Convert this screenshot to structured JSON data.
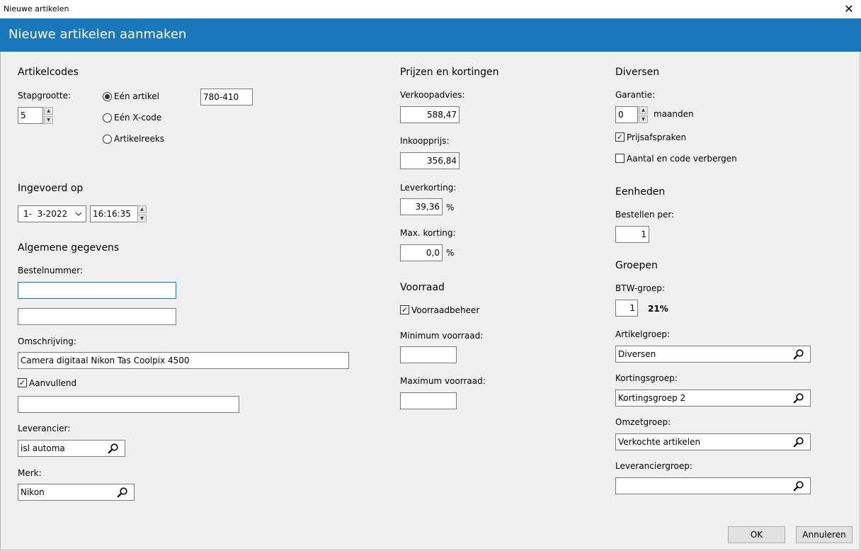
{
  "window": {
    "title": "Nieuwe artikelen",
    "close_glyph": "✕"
  },
  "banner": {
    "heading": "Nieuwe artikelen aanmaken"
  },
  "artikelcodes": {
    "heading": "Artikelcodes",
    "stapgrootte_label": "Stapgrootte:",
    "stapgrootte_value": "5",
    "options": [
      "Eén artikel",
      "Eén X-code",
      "Artikelreeks"
    ],
    "selected_option": "Eén artikel",
    "code_value": "780-410"
  },
  "ingevoerd": {
    "heading": "Ingevoerd op",
    "date_value": "1-  3-2022",
    "time_value": "16:16:35"
  },
  "algemeen": {
    "heading": "Algemene gegevens",
    "bestelnummer_label": "Bestelnummer:",
    "bestelnummer_value": "",
    "bestelnummer2_value": "",
    "omschrijving_label": "Omschrijving:",
    "omschrijving_value": "Camera digitaal Nikon Tas Coolpix 4500",
    "aanvullend_label": "Aanvullend",
    "aanvullend_checked": true,
    "aanvullend_value": "",
    "leverancier_label": "Leverancier:",
    "leverancier_value": "isl automa",
    "merk_label": "Merk:",
    "merk_value": "Nikon"
  },
  "prijzen": {
    "heading": "Prijzen en kortingen",
    "verkoopadvies_label": "Verkoopadvies:",
    "verkoopadvies_value": "588,47",
    "inkoopprijs_label": "Inkoopprijs:",
    "inkoopprijs_value": "356,84",
    "leverkorting_label": "Leverkorting:",
    "leverkorting_value": "39,36",
    "max_korting_label": "Max. korting:",
    "max_korting_value": "0,0",
    "percent": "%"
  },
  "voorraad": {
    "heading": "Voorraad",
    "voorraadbeheer_label": "Voorraadbeheer",
    "voorraadbeheer_checked": true,
    "minimum_label": "Minimum voorraad:",
    "minimum_value": "",
    "maximum_label": "Maximum voorraad:",
    "maximum_value": ""
  },
  "diversen": {
    "heading": "Diversen",
    "garantie_label": "Garantie:",
    "garantie_value": "0",
    "maanden_label": "maanden",
    "prijsafspraken_label": "Prijsafspraken",
    "prijsafspraken_checked": true,
    "verbergen_label": "Aantal en code verbergen",
    "verbergen_checked": false
  },
  "eenheden": {
    "heading": "Eenheden",
    "bestellen_per_label": "Bestellen per:",
    "bestellen_per_value": "1"
  },
  "groepen": {
    "heading": "Groepen",
    "btw_label": "BTW-groep:",
    "btw_value": "1",
    "btw_percent": "21%",
    "artikelgroep_label": "Artikelgroep:",
    "artikelgroep_value": "Diversen",
    "kortingsgroep_label": "Kortingsgroep:",
    "kortingsgroep_value": "Kortingsgroep 2",
    "omzetgroep_label": "Omzetgroep:",
    "omzetgroep_value": "Verkochte artikelen",
    "leveranciergroep_label": "Leveranciergroep:",
    "leveranciergroep_value": ""
  },
  "buttons": {
    "ok": "OK",
    "annuleren": "Annuleren"
  },
  "icons": {
    "search": "search-icon",
    "close": "close-icon",
    "chevron": "chevron-down-icon",
    "check": "checkmark-icon"
  },
  "colors": {
    "banner": "#1a77bb",
    "background": "#f0f0f0",
    "focus_border": "#0078d7"
  }
}
